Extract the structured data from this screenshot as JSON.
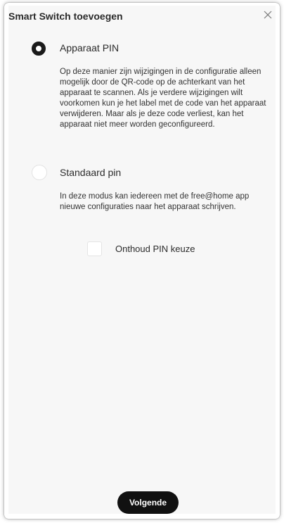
{
  "dialog": {
    "title": "Smart Switch toevoegen",
    "close_icon": "close-icon"
  },
  "options": [
    {
      "label": "Apparaat PIN",
      "selected": true,
      "description": "Op deze manier zijn wijzigingen in de configuratie alleen mogelijk door de QR-code op de achterkant van het apparaat te scannen. Als je verdere wijzigingen wilt voorkomen kun je het label met de code van het apparaat verwijderen. Maar als je deze code verliest, kan het apparaat niet meer worden geconfigureerd."
    },
    {
      "label": "Standaard pin",
      "selected": false,
      "description": "In deze modus kan iedereen met de free@home app nieuwe configuraties naar het apparaat schrijven."
    }
  ],
  "remember": {
    "label": "Onthoud PIN keuze",
    "checked": false
  },
  "footer": {
    "next_label": "Volgende"
  },
  "colors": {
    "dialog_background": "#f7f7f7",
    "button_background": "#111111",
    "button_text": "#ffffff",
    "radio_selected": "#1a1a1a"
  }
}
